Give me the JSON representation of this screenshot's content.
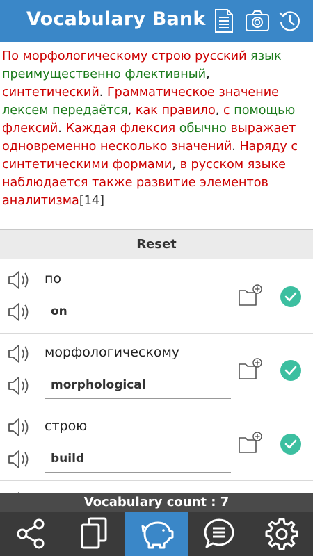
{
  "header": {
    "title": "Vocabulary Bank",
    "icons": [
      "document-icon",
      "camera-icon",
      "history-icon"
    ]
  },
  "text": {
    "words": [
      {
        "t": "По",
        "c": "red"
      },
      {
        "t": " "
      },
      {
        "t": "морфологическому",
        "c": "red"
      },
      {
        "t": " "
      },
      {
        "t": "строю",
        "c": "red"
      },
      {
        "t": " "
      },
      {
        "t": "русский",
        "c": "red"
      },
      {
        "t": " "
      },
      {
        "t": "язык",
        "c": "green"
      },
      {
        "t": " "
      },
      {
        "t": "преимущественно",
        "c": "green"
      },
      {
        "t": " "
      },
      {
        "t": "флективный",
        "c": "green"
      },
      {
        "t": ","
      },
      {
        "t": " "
      },
      {
        "t": "синтетический",
        "c": "red"
      },
      {
        "t": "."
      },
      {
        "t": " "
      },
      {
        "t": "Грамматическое",
        "c": "red"
      },
      {
        "t": " "
      },
      {
        "t": "значение",
        "c": "red"
      },
      {
        "t": " "
      },
      {
        "t": "лексем",
        "c": "green"
      },
      {
        "t": " "
      },
      {
        "t": "передаётся",
        "c": "green"
      },
      {
        "t": ","
      },
      {
        "t": " "
      },
      {
        "t": "как",
        "c": "red"
      },
      {
        "t": " "
      },
      {
        "t": "правило",
        "c": "red"
      },
      {
        "t": ","
      },
      {
        "t": " "
      },
      {
        "t": "с",
        "c": "red"
      },
      {
        "t": " "
      },
      {
        "t": "помощью",
        "c": "green"
      },
      {
        "t": " "
      },
      {
        "t": "флексий",
        "c": "red"
      },
      {
        "t": "."
      },
      {
        "t": " "
      },
      {
        "t": "Каждая",
        "c": "red"
      },
      {
        "t": " "
      },
      {
        "t": "флексия",
        "c": "red"
      },
      {
        "t": " "
      },
      {
        "t": "обычно",
        "c": "green"
      },
      {
        "t": " "
      },
      {
        "t": "выражает",
        "c": "red"
      },
      {
        "t": " "
      },
      {
        "t": "одновременно",
        "c": "red"
      },
      {
        "t": " "
      },
      {
        "t": "несколько",
        "c": "red"
      },
      {
        "t": " "
      },
      {
        "t": "значений",
        "c": "red"
      },
      {
        "t": "."
      },
      {
        "t": " "
      },
      {
        "t": "Наряду",
        "c": "red"
      },
      {
        "t": " "
      },
      {
        "t": "с",
        "c": "red"
      },
      {
        "t": " "
      },
      {
        "t": "синтетическими",
        "c": "red"
      },
      {
        "t": " "
      },
      {
        "t": "формами",
        "c": "red"
      },
      {
        "t": ","
      },
      {
        "t": " "
      },
      {
        "t": "в",
        "c": "red"
      },
      {
        "t": " "
      },
      {
        "t": "русском",
        "c": "red"
      },
      {
        "t": " "
      },
      {
        "t": "языке",
        "c": "red"
      },
      {
        "t": " "
      },
      {
        "t": "наблюдается",
        "c": "red"
      },
      {
        "t": " "
      },
      {
        "t": "также",
        "c": "red"
      },
      {
        "t": " "
      },
      {
        "t": "развитие",
        "c": "red"
      },
      {
        "t": " "
      },
      {
        "t": "элементов",
        "c": "red"
      },
      {
        "t": " "
      },
      {
        "t": "аналитизма",
        "c": "red"
      },
      {
        "t": "[14]",
        "c": "dark"
      }
    ]
  },
  "reset_label": "Reset",
  "vocab_items": [
    {
      "word": "по",
      "translation": "on"
    },
    {
      "word": "морфологическому",
      "translation": "morphological"
    },
    {
      "word": "строю",
      "translation": "build"
    },
    {
      "word": "",
      "translation": ""
    }
  ],
  "count_label": "Vocabulary count : 7",
  "nav": [
    {
      "icon": "share-icon",
      "active": false
    },
    {
      "icon": "cards-icon",
      "active": false
    },
    {
      "icon": "piggy-bank-icon",
      "active": true
    },
    {
      "icon": "chat-menu-icon",
      "active": false
    },
    {
      "icon": "settings-icon",
      "active": false
    }
  ],
  "colors": {
    "header": "#3a87c8",
    "red_word": "#cc0000",
    "green_word": "#1a7a1a",
    "check": "#3cbfa0",
    "nav_bg": "#3a3a3a"
  }
}
